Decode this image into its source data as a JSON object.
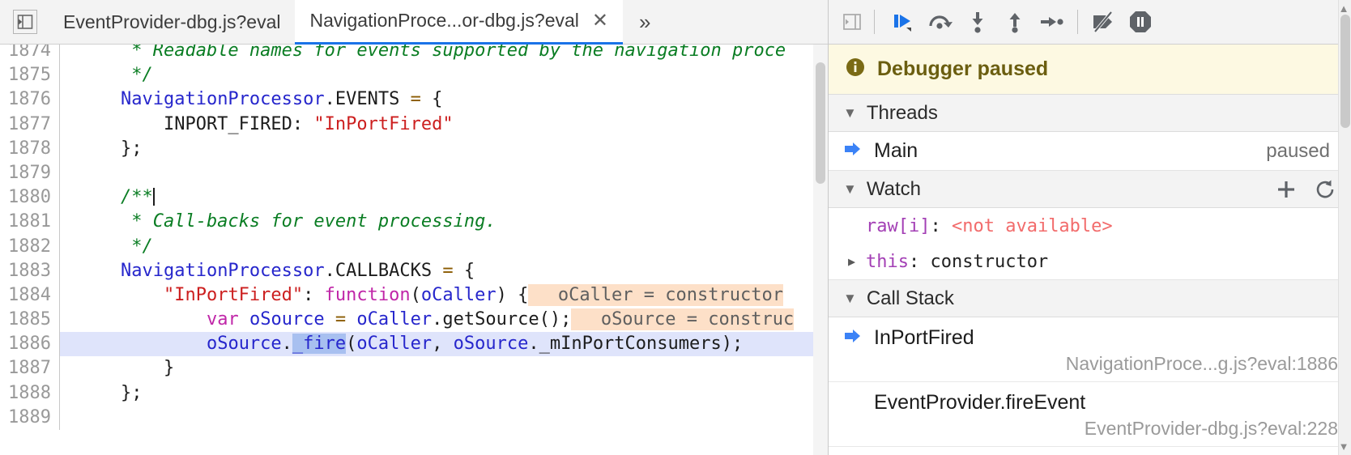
{
  "window": {
    "app": "Chrome DevTools Sources Panel"
  },
  "tabstrip": {
    "nav_prev_icon": "panel-collapse-left-icon",
    "tabs": [
      {
        "label": "EventProvider-dbg.js?eval",
        "active": false,
        "closable": false
      },
      {
        "label": "NavigationProce...or-dbg.js?eval",
        "active": true,
        "closable": true,
        "close_glyph": "✕"
      }
    ],
    "overflow_glyph": "»",
    "overflow_name": "more-tabs"
  },
  "editor": {
    "first_line": 1874,
    "lines": [
      {
        "num": "1874",
        "tokens": [
          {
            "t": "     * Readable names for events supported by the navigation proce",
            "c": "c-comment"
          }
        ]
      },
      {
        "num": "1875",
        "tokens": [
          {
            "t": "     */",
            "c": "c-comment"
          }
        ]
      },
      {
        "num": "1876",
        "tokens": [
          {
            "t": "    ",
            "c": "c-plain"
          },
          {
            "t": "NavigationProcessor",
            "c": "c-ident"
          },
          {
            "t": ".EVENTS ",
            "c": "c-plain"
          },
          {
            "t": "=",
            "c": "c-op"
          },
          {
            "t": " {",
            "c": "c-plain"
          }
        ]
      },
      {
        "num": "1877",
        "tokens": [
          {
            "t": "        INPORT_FIRED: ",
            "c": "c-plain"
          },
          {
            "t": "\"InPortFired\"",
            "c": "c-string"
          }
        ]
      },
      {
        "num": "1878",
        "tokens": [
          {
            "t": "    };",
            "c": "c-plain"
          }
        ]
      },
      {
        "num": "1879",
        "tokens": [
          {
            "t": "",
            "c": "c-plain"
          }
        ]
      },
      {
        "num": "1880",
        "tokens": [
          {
            "t": "    /**",
            "c": "c-comment"
          }
        ],
        "caret_after": true
      },
      {
        "num": "1881",
        "tokens": [
          {
            "t": "     * Call-backs for event processing.",
            "c": "c-comment"
          }
        ]
      },
      {
        "num": "1882",
        "tokens": [
          {
            "t": "     */",
            "c": "c-comment"
          }
        ]
      },
      {
        "num": "1883",
        "tokens": [
          {
            "t": "    ",
            "c": "c-plain"
          },
          {
            "t": "NavigationProcessor",
            "c": "c-ident"
          },
          {
            "t": ".CALLBACKS ",
            "c": "c-plain"
          },
          {
            "t": "=",
            "c": "c-op"
          },
          {
            "t": " {",
            "c": "c-plain"
          }
        ]
      },
      {
        "num": "1884",
        "tokens": [
          {
            "t": "        ",
            "c": "c-plain"
          },
          {
            "t": "\"InPortFired\"",
            "c": "c-string"
          },
          {
            "t": ": ",
            "c": "c-plain"
          },
          {
            "t": "function",
            "c": "c-kw"
          },
          {
            "t": "(",
            "c": "c-plain"
          },
          {
            "t": "oCaller",
            "c": "c-ident"
          },
          {
            "t": ") {",
            "c": "c-plain"
          }
        ],
        "hint": "oCaller = constructor"
      },
      {
        "num": "1885",
        "tokens": [
          {
            "t": "            ",
            "c": "c-plain"
          },
          {
            "t": "var",
            "c": "c-kw"
          },
          {
            "t": " ",
            "c": "c-plain"
          },
          {
            "t": "oSource",
            "c": "c-ident"
          },
          {
            "t": " ",
            "c": "c-plain"
          },
          {
            "t": "=",
            "c": "c-op"
          },
          {
            "t": " ",
            "c": "c-plain"
          },
          {
            "t": "oCaller",
            "c": "c-ident"
          },
          {
            "t": ".getSource();",
            "c": "c-plain"
          }
        ],
        "hint": "oSource = construc"
      },
      {
        "num": "1886",
        "exec": true,
        "tokens": [
          {
            "t": "            ",
            "c": "c-plain"
          },
          {
            "t": "oSource",
            "c": "c-ident"
          },
          {
            "t": ".",
            "c": "c-plain"
          },
          {
            "t": "_fire",
            "c": "c-ident c-sel"
          },
          {
            "t": "(",
            "c": "c-plain"
          },
          {
            "t": "oCaller",
            "c": "c-ident"
          },
          {
            "t": ", ",
            "c": "c-plain"
          },
          {
            "t": "oSource",
            "c": "c-ident"
          },
          {
            "t": "._mInPortConsumers);",
            "c": "c-plain"
          }
        ]
      },
      {
        "num": "1887",
        "tokens": [
          {
            "t": "        }",
            "c": "c-plain"
          }
        ]
      },
      {
        "num": "1888",
        "tokens": [
          {
            "t": "    };",
            "c": "c-plain"
          }
        ]
      },
      {
        "num": "1889",
        "tokens": [
          {
            "t": "",
            "c": "c-plain"
          }
        ]
      }
    ]
  },
  "debug_toolbar": {
    "panel_toggle_icon": "panel-expand-right-icon",
    "buttons": [
      {
        "name": "resume-button",
        "icon": "resume-script-execution-icon",
        "accent": "#1a73e8"
      },
      {
        "name": "step-over-button",
        "icon": "step-over-next-function-call-icon",
        "accent": "#5f6368"
      },
      {
        "name": "step-into-button",
        "icon": "step-into-next-function-call-icon",
        "accent": "#5f6368"
      },
      {
        "name": "step-out-button",
        "icon": "step-out-of-current-function-icon",
        "accent": "#5f6368"
      },
      {
        "name": "step-button",
        "icon": "step-icon",
        "accent": "#5f6368"
      },
      {
        "name": "deactivate-breakpoints-button",
        "icon": "deactivate-breakpoints-icon",
        "accent": "#5f6368"
      },
      {
        "name": "pause-on-exceptions-button",
        "icon": "pause-on-exceptions-icon",
        "accent": "#5f6368"
      }
    ]
  },
  "paused_banner": {
    "icon": "info-icon",
    "text": "Debugger paused",
    "bg": "#fdf9e2",
    "fg": "#6b5e10"
  },
  "threads": {
    "title": "Threads",
    "collapse_glyph": "▼",
    "rows": [
      {
        "name": "Main",
        "state": "paused",
        "marker_icon": "current-thread-arrow-icon"
      }
    ]
  },
  "watch": {
    "title": "Watch",
    "collapse_glyph": "▼",
    "add_label": "+",
    "add_name": "add-watch-expression-button",
    "refresh_name": "refresh-watch-expressions-button",
    "rows": [
      {
        "disclosure": "",
        "name": "raw[i]",
        "sep": ": ",
        "value": "<not available>",
        "name_class": "w-name-purple",
        "value_class": "w-val-red"
      },
      {
        "disclosure": "▶",
        "name": "this",
        "sep": ": ",
        "value": "constructor",
        "name_class": "w-name-purple",
        "value_class": "w-val-dark"
      }
    ]
  },
  "call_stack": {
    "title": "Call Stack",
    "collapse_glyph": "▼",
    "frames": [
      {
        "function": "InPortFired",
        "location": "NavigationProce...g.js?eval:1886",
        "selected": true,
        "marker_icon": "current-call-frame-arrow-icon"
      },
      {
        "function": "EventProvider.fireEvent",
        "location": "EventProvider-dbg.js?eval:228",
        "selected": false,
        "marker_icon": ""
      }
    ]
  },
  "colors": {
    "accent_blue": "#1a73e8",
    "exec_line_bg": "#dfe4fb",
    "exec_line_border": "#3f6fd8",
    "inline_hint_bg": "#fde0c8",
    "banner_bg": "#fdf9e2"
  }
}
